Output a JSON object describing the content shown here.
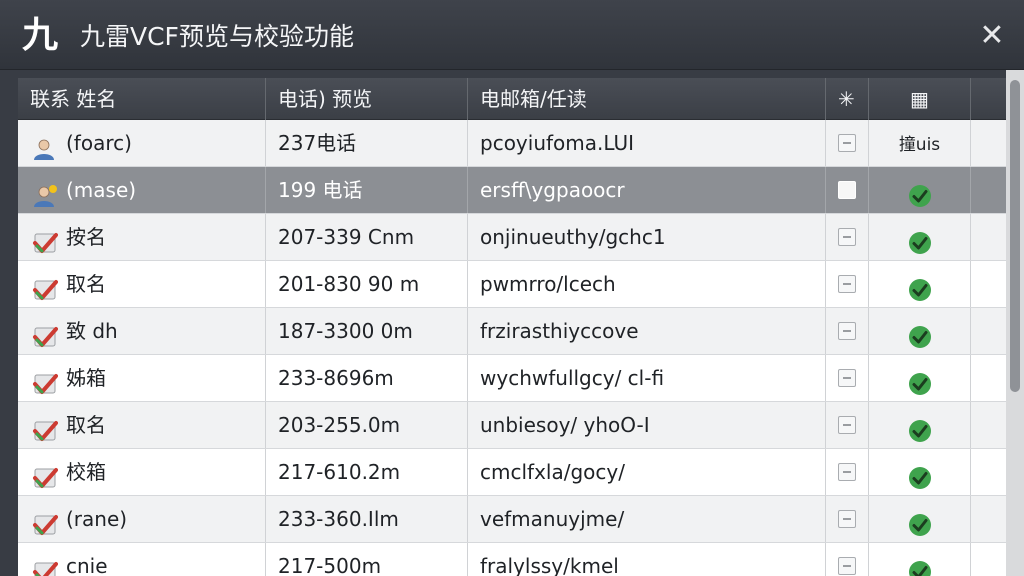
{
  "window": {
    "app_icon_glyph": "九",
    "title": "九雷VCF预览与校验功能",
    "close_glyph": "✕"
  },
  "table": {
    "columns": [
      "联系 姓名",
      "电话) 预览",
      "电邮箱/任读",
      "",
      ""
    ],
    "check_header_glyph": "✳",
    "status_header_glyph": "▦",
    "rows": [
      {
        "icon": "user-avatar-icon",
        "name": "(foarc)",
        "phone": "237电话",
        "email": "pcoyiufoma.LUI",
        "checked": false,
        "status_text": "撞uis",
        "status": "text"
      },
      {
        "icon": "user-avatar-new-icon",
        "name": "(mase)",
        "phone": "199 电话",
        "email": "ersff\\ygpaoocr",
        "checked": false,
        "status_text": "",
        "status": "check",
        "selected": true
      },
      {
        "icon": "vcard-check-icon",
        "name": "按名",
        "phone": "207-339 Cnm",
        "email": "onjinueuthy/gchc1",
        "checked": false,
        "status_text": "",
        "status": "check"
      },
      {
        "icon": "vcard-check-icon",
        "name": "取名",
        "phone": "201-830 90 m",
        "email": "pwmrro/lcech",
        "checked": false,
        "status_text": "",
        "status": "check"
      },
      {
        "icon": "vcard-check-icon",
        "name": "致 dh",
        "phone": "187-3300 0m",
        "email": "frzirasthiyccove",
        "checked": false,
        "status_text": "",
        "status": "check"
      },
      {
        "icon": "vcard-check-icon",
        "name": "姊箱",
        "phone": "233-8696m",
        "email": "wychwfullgcy/ cl-fi",
        "checked": false,
        "status_text": "",
        "status": "check"
      },
      {
        "icon": "vcard-check-icon",
        "name": "取名",
        "phone": "203-255.0m",
        "email": "unbiesoy/ yhoO-I",
        "checked": false,
        "status_text": "",
        "status": "check"
      },
      {
        "icon": "vcard-check-icon",
        "name": "校箱",
        "phone": "217-610.2m",
        "email": "cmclfxla/gocy/",
        "checked": false,
        "status_text": "",
        "status": "check"
      },
      {
        "icon": "vcard-check-icon",
        "name": "(rane)",
        "phone": "233-360.Ilm",
        "email": "vefmanuyjme/",
        "checked": false,
        "status_text": "",
        "status": "check"
      },
      {
        "icon": "vcard-check-icon",
        "name": "cnie",
        "phone": "217-500m",
        "email": "fralylssy/kmel",
        "checked": false,
        "status_text": "",
        "status": "check"
      }
    ]
  },
  "colors": {
    "titlebar": "#383c44",
    "selected_row": "#8c8f94",
    "check_green": "#3fa34d",
    "icon_red": "#cc3b32",
    "icon_blue": "#4a78b8"
  }
}
